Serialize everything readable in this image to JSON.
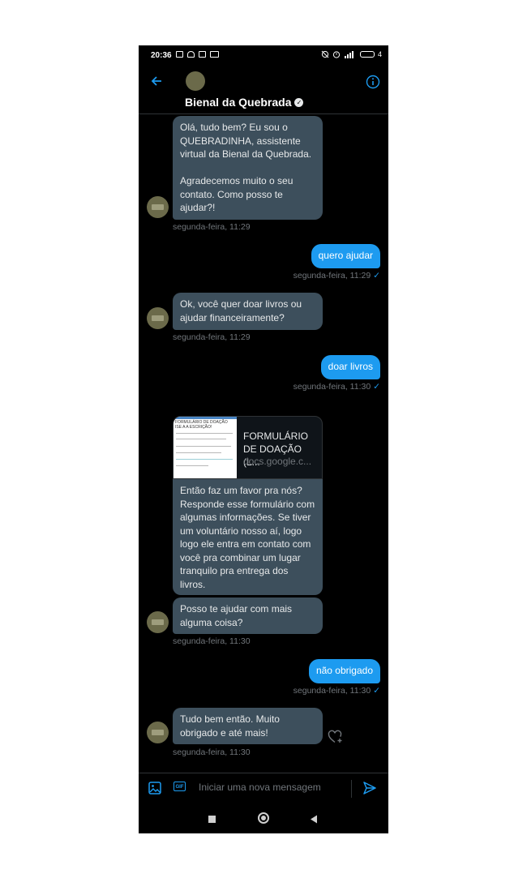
{
  "status": {
    "time": "20:36",
    "battery": "4"
  },
  "header": {
    "name": "Bienal da Quebrada",
    "verified": true
  },
  "messages": [
    {
      "from": "bot",
      "text": "Olá, tudo bem? Eu sou o QUEBRADINHA, assistente virtual da Bienal da Quebrada.\n\nAgradecemos muito o seu contato. Como posso te ajudar?!",
      "time": "segunda-feira, 11:29"
    },
    {
      "from": "user",
      "text": "quero ajudar",
      "time": "segunda-feira, 11:29"
    },
    {
      "from": "bot",
      "text": "Ok, você quer doar livros ou ajudar financeiramente?",
      "time": "segunda-feira, 11:29"
    },
    {
      "from": "user",
      "text": "doar livros",
      "time": "segunda-feira, 11:30"
    },
    {
      "from": "bot",
      "text": "Então faz um favor pra nós? Responde esse formulário com algumas informações. Se tiver um voluntário nosso aí, logo logo ele entra em contato com você pra combinar um lugar tranquilo pra entrega dos livros."
    },
    {
      "from": "bot",
      "text": "Posso te ajudar com mais alguma coisa?",
      "time": "segunda-feira, 11:30"
    },
    {
      "from": "user",
      "text": "não obrigado",
      "time": "segunda-feira, 11:30"
    },
    {
      "from": "bot",
      "text": "Tudo bem então. Muito obrigado e até mais!",
      "time": "segunda-feira, 11:30"
    }
  ],
  "link_card": {
    "title": "FORMULÁRIO DE DOAÇÃO (L...",
    "domain": "docs.google.c...",
    "thumb_title": "FORMULÁRIO DE DOAÇÃO ISE A A ESCRIÇÃO!"
  },
  "composer": {
    "placeholder": "Iniciar uma nova mensagem"
  },
  "colors": {
    "accent": "#1d9bf0",
    "bubble_in": "#3d4f5c",
    "background": "#000000"
  },
  "icons": [
    "back-arrow-icon",
    "info-icon",
    "verified-icon",
    "image-icon",
    "gif-icon",
    "send-icon",
    "heart-add-icon",
    "nav-square-icon",
    "nav-circle-icon",
    "nav-back-icon"
  ]
}
